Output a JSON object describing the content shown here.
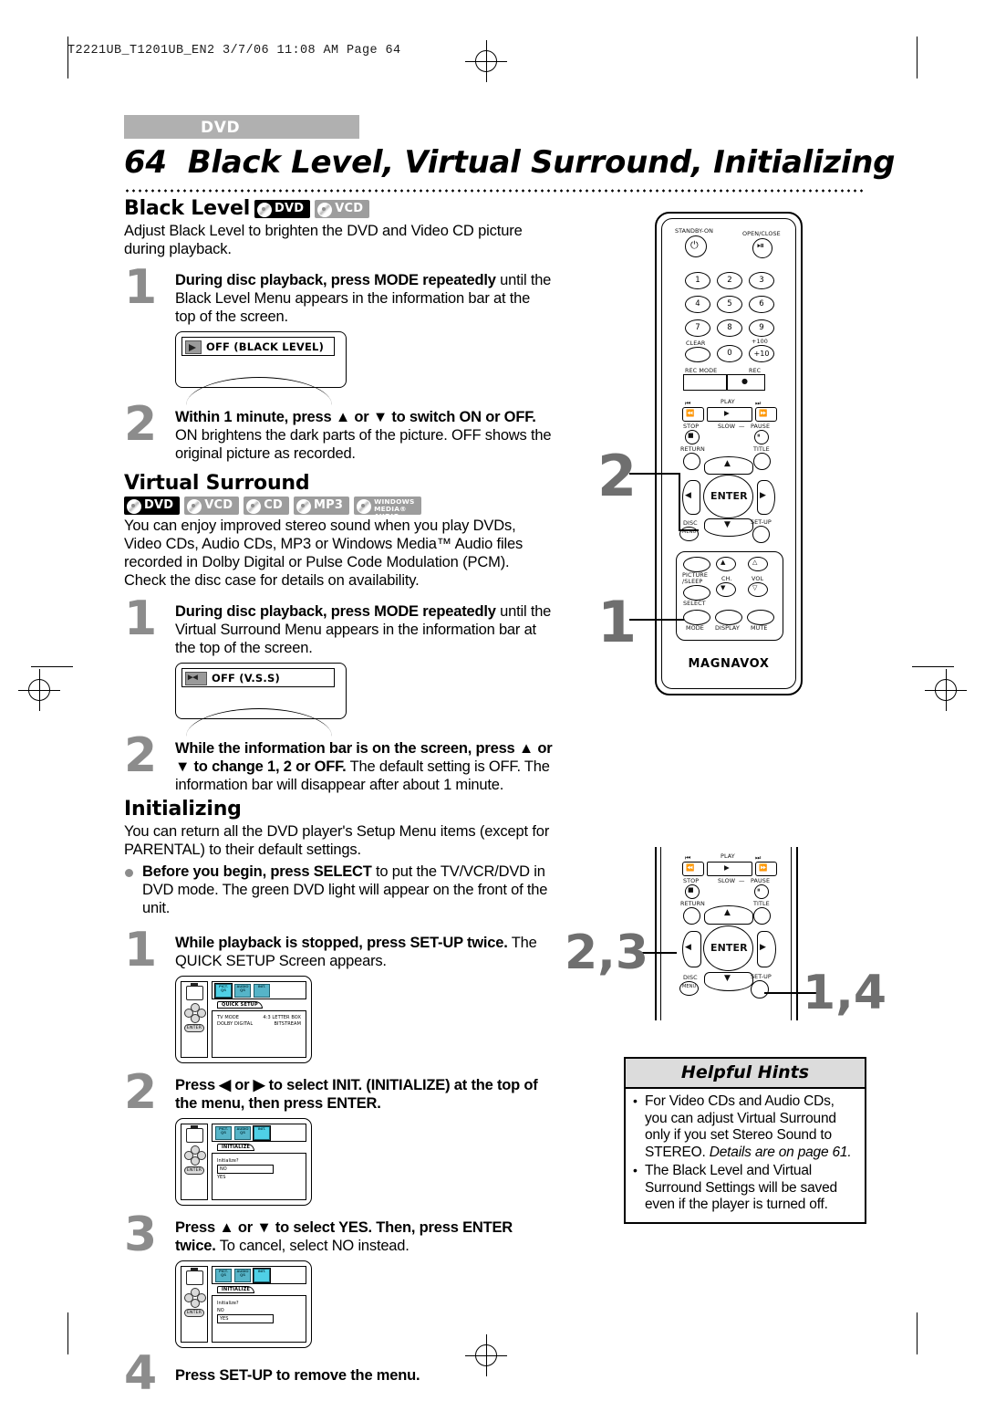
{
  "print_marks": {
    "filestamp": "T2221UB_T1201UB_EN2  3/7/06  11:08 AM  Page 64"
  },
  "header": {
    "section_tab": "DVD",
    "page_number": "64",
    "title": "Black Level, Virtual Surround, Initializing"
  },
  "sections": {
    "black_level": {
      "heading": "Black Level",
      "badges": [
        "DVD",
        "VCD"
      ],
      "intro": "Adjust Black Level to brighten the DVD and Video CD picture during playback.",
      "steps": [
        {
          "number": "1",
          "bold": "During disc playback, press MODE repeatedly",
          "rest": "until the Black Level Menu appears in the information bar at the top of the screen.",
          "osd_label": "OFF (BLACK LEVEL)"
        },
        {
          "number": "2",
          "bold": "Within 1 minute, press ▲ or ▼ to switch ON or OFF.",
          "rest": "ON brightens the dark parts of the picture. OFF shows the original picture as recorded."
        }
      ]
    },
    "virtual_surround": {
      "heading": "Virtual Surround",
      "badges": [
        "DVD",
        "VCD",
        "CD",
        "MP3",
        "WINDOWS MEDIA AUDIO"
      ],
      "intro": "You can enjoy improved stereo sound when you play DVDs, Video CDs, Audio CDs, MP3 or Windows Media™ Audio files recorded in Dolby Digital or Pulse Code Modulation (PCM). Check the disc case for details on availability.",
      "steps": [
        {
          "number": "1",
          "bold": "During disc playback, press MODE repeatedly",
          "rest": "until the Virtual Surround Menu appears in the information bar at the top of the screen.",
          "osd_label": "OFF (V.S.S)"
        },
        {
          "number": "2",
          "bold": "While the information bar is on the screen, press ▲ or ▼ to change 1, 2 or OFF.",
          "rest": "The default setting is OFF. The information bar will disappear after about 1 minute."
        }
      ]
    },
    "initializing": {
      "heading": "Initializing",
      "intro": "You can return all the DVD player's Setup Menu items (except for PARENTAL) to their default settings.",
      "bullet_bold": "Before you begin, press SELECT",
      "bullet_rest": "to put the TV/VCR/DVD in DVD mode. The green DVD light will appear on the front of the unit.",
      "steps": [
        {
          "number": "1",
          "bold": "While playback is stopped, press SET-UP twice.",
          "rest": "The QUICK SETUP Screen appears."
        },
        {
          "number": "2",
          "bold": "Press ◀ or ▶ to select INIT. (INITIALIZE) at the top of the menu, then press ENTER.",
          "rest": ""
        },
        {
          "number": "3",
          "bold": "Press ▲ or ▼ to select YES. Then, press ENTER twice.",
          "rest": "To cancel, select NO instead."
        },
        {
          "number": "4",
          "bold": "Press SET-UP to remove the menu.",
          "rest": ""
        }
      ]
    }
  },
  "menu_mocks": {
    "quick_setup": {
      "tab": "QUICK SETUP",
      "icons": [
        "PICT. QS",
        "AUDIO QS",
        "INIT."
      ],
      "selected_icon_index": 0,
      "rows": [
        {
          "left": "TV MODE",
          "right": "4:3 LETTER BOX"
        },
        {
          "left": "DOLBY DIGITAL",
          "right": "BITSTREAM"
        }
      ]
    },
    "initialize_no": {
      "tab": "INITIALIZE",
      "icons": [
        "PICT. QS",
        "AUDIO QS",
        "INIT."
      ],
      "selected_icon_index": 2,
      "question": "Initialize?",
      "options": [
        "NO",
        "YES"
      ],
      "highlighted": "NO"
    },
    "initialize_yes": {
      "tab": "INITIALIZE",
      "icons": [
        "PICT. QS",
        "AUDIO QS",
        "INIT."
      ],
      "selected_icon_index": 2,
      "question": "Initialize?",
      "options": [
        "NO",
        "YES"
      ],
      "highlighted": "YES"
    }
  },
  "remote_top": {
    "brand": "MAGNAVOX",
    "labels": {
      "standby": "STANDBY-ON",
      "open_close": "OPEN/CLOSE",
      "clear": "CLEAR",
      "plus100": "+100",
      "plus10": "+10",
      "rec_mode": "REC MODE",
      "rec": "REC",
      "play": "PLAY",
      "stop": "STOP",
      "slow": "SLOW",
      "pause": "PAUSE",
      "return": "RETURN",
      "title": "TITLE",
      "enter": "ENTER",
      "disc_menu": "DISC",
      "disc_menu2": "MENU",
      "setup": "SET-UP",
      "picture": "PICTURE",
      "sleep": "/SLEEP",
      "ch": "CH.",
      "vol": "VOL",
      "select": "SELECT",
      "mode": "MODE",
      "display": "DISPLAY",
      "mute": "MUTE"
    },
    "number_keys": [
      "1",
      "2",
      "3",
      "4",
      "5",
      "6",
      "7",
      "8",
      "9",
      "0"
    ],
    "callout_up_down": "2",
    "callout_mode": "1"
  },
  "remote_bottom": {
    "labels": {
      "play": "PLAY",
      "stop": "STOP",
      "slow": "SLOW",
      "pause": "PAUSE",
      "return": "RETURN",
      "title": "TITLE",
      "enter": "ENTER",
      "disc_menu": "DISC",
      "disc_menu2": "MENU",
      "setup": "SET-UP"
    },
    "callout_arrows": "2,3",
    "callout_setup": "1,4"
  },
  "helpful_hints": {
    "title": "Helpful Hints",
    "items": [
      {
        "text": "For Video CDs and Audio CDs, you can adjust Virtual Surround only if you set Stereo Sound to STEREO. ",
        "italic": "Details are on page 61."
      },
      {
        "text": "The Black Level and Virtual Surround Settings will be saved even if the player is turned off.",
        "italic": ""
      }
    ]
  }
}
